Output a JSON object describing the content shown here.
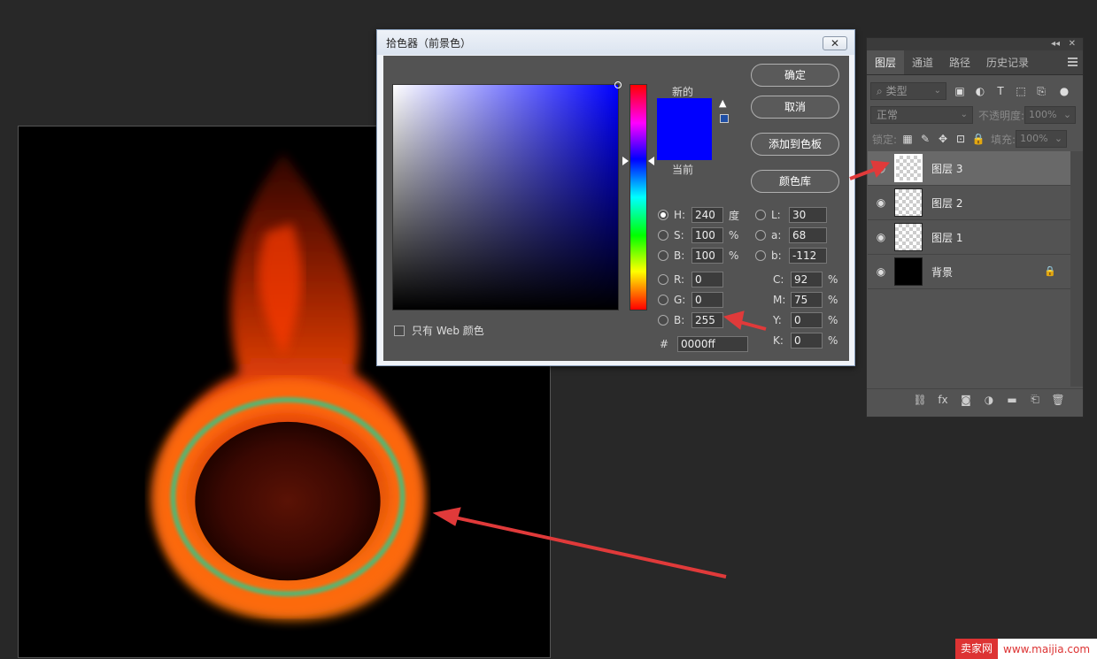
{
  "dialog": {
    "title": "拾色器（前景色）",
    "close_glyph": "✕",
    "new_label": "新的",
    "current_label": "当前",
    "new_color": "#0000ff",
    "current_color": "#0000ff",
    "web_only_label": "只有 Web 颜色",
    "buttons": {
      "ok": "确定",
      "cancel": "取消",
      "add_to_swatches": "添加到色板",
      "color_libraries": "颜色库"
    },
    "fields": {
      "H": {
        "label": "H:",
        "value": "240",
        "unit": "度"
      },
      "S": {
        "label": "S:",
        "value": "100",
        "unit": "%"
      },
      "B": {
        "label": "B:",
        "value": "100",
        "unit": "%"
      },
      "R": {
        "label": "R:",
        "value": "0"
      },
      "G": {
        "label": "G:",
        "value": "0"
      },
      "B2": {
        "label": "B:",
        "value": "255"
      },
      "L": {
        "label": "L:",
        "value": "30"
      },
      "a": {
        "label": "a:",
        "value": "68"
      },
      "b": {
        "label": "b:",
        "value": "-112"
      },
      "C": {
        "label": "C:",
        "value": "92",
        "unit": "%"
      },
      "M": {
        "label": "M:",
        "value": "75",
        "unit": "%"
      },
      "Y": {
        "label": "Y:",
        "value": "0",
        "unit": "%"
      },
      "K": {
        "label": "K:",
        "value": "0",
        "unit": "%"
      },
      "hex": {
        "label": "#",
        "value": "0000ff"
      }
    }
  },
  "layers_panel": {
    "tabs": [
      "图层",
      "通道",
      "路径",
      "历史记录"
    ],
    "filter_placeholder": "类型",
    "blend_mode": "正常",
    "opacity_label": "不透明度:",
    "opacity_value": "100%",
    "lock_label": "锁定:",
    "fill_label": "填充:",
    "fill_value": "100%",
    "layers": [
      {
        "name": "图层 3",
        "selected": true
      },
      {
        "name": "图层 2",
        "selected": false
      },
      {
        "name": "图层 1",
        "selected": false
      },
      {
        "name": "背景",
        "selected": false,
        "locked": true
      }
    ]
  },
  "watermark": {
    "brand": "卖家网",
    "url": "www.maijia.com"
  },
  "colors": {
    "accent_red": "#e03a3a",
    "panel_bg": "#535353",
    "app_bg": "#282828"
  }
}
